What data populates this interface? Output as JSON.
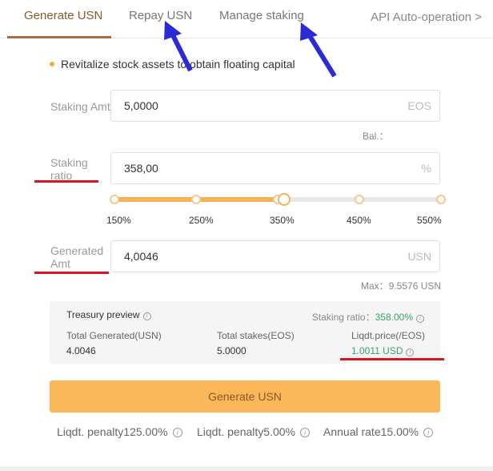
{
  "tabs": [
    {
      "label": "Generate USN"
    },
    {
      "label": "Repay USN"
    },
    {
      "label": "Manage staking"
    }
  ],
  "api_link": "API Auto-operation >",
  "notice": "Revitalize stock assets to obtain floating capital",
  "staking_amt": {
    "label": "Staking Amt",
    "value": "5,0000",
    "unit": "EOS",
    "balance": "Bal.："
  },
  "staking_ratio": {
    "label_line1": "Staking",
    "label_line2": "ratio",
    "value": "358,00",
    "unit": "%"
  },
  "slider": {
    "ticks": [
      "150%",
      "250%",
      "350%",
      "450%",
      "550%"
    ],
    "min": 150,
    "max": 550,
    "current": 358
  },
  "generated_amt": {
    "label_line1": "Generated",
    "label_line2": "Amt",
    "value": "4,0046",
    "unit": "USN",
    "max": "Max：9.5576 USN"
  },
  "preview": {
    "title": "Treasury preview",
    "ratio_label": "Staking ratio：",
    "ratio_value": "358.00%",
    "total_generated_label": "Total Generated(USN)",
    "total_generated_value": "4.0046",
    "total_stakes_label": "Total stakes(EOS)",
    "total_stakes_value": "5.0000",
    "liqdt_label": "Liqdt.price(/EOS)",
    "liqdt_value": "1.0011 USD"
  },
  "generate_button": "Generate USN",
  "footer": [
    {
      "label": "Liqdt. penalty",
      "value": "125.00%"
    },
    {
      "label": "Liqdt. penalty",
      "value": "5.00%"
    },
    {
      "label": "Annual rate",
      "value": "15.00%"
    }
  ],
  "colors": {
    "accent": "#fbb759",
    "brand": "#a86b3c",
    "annotation_red": "#d8161f",
    "annotation_arrow": "#2b2bd6",
    "positive": "#39a36b"
  }
}
